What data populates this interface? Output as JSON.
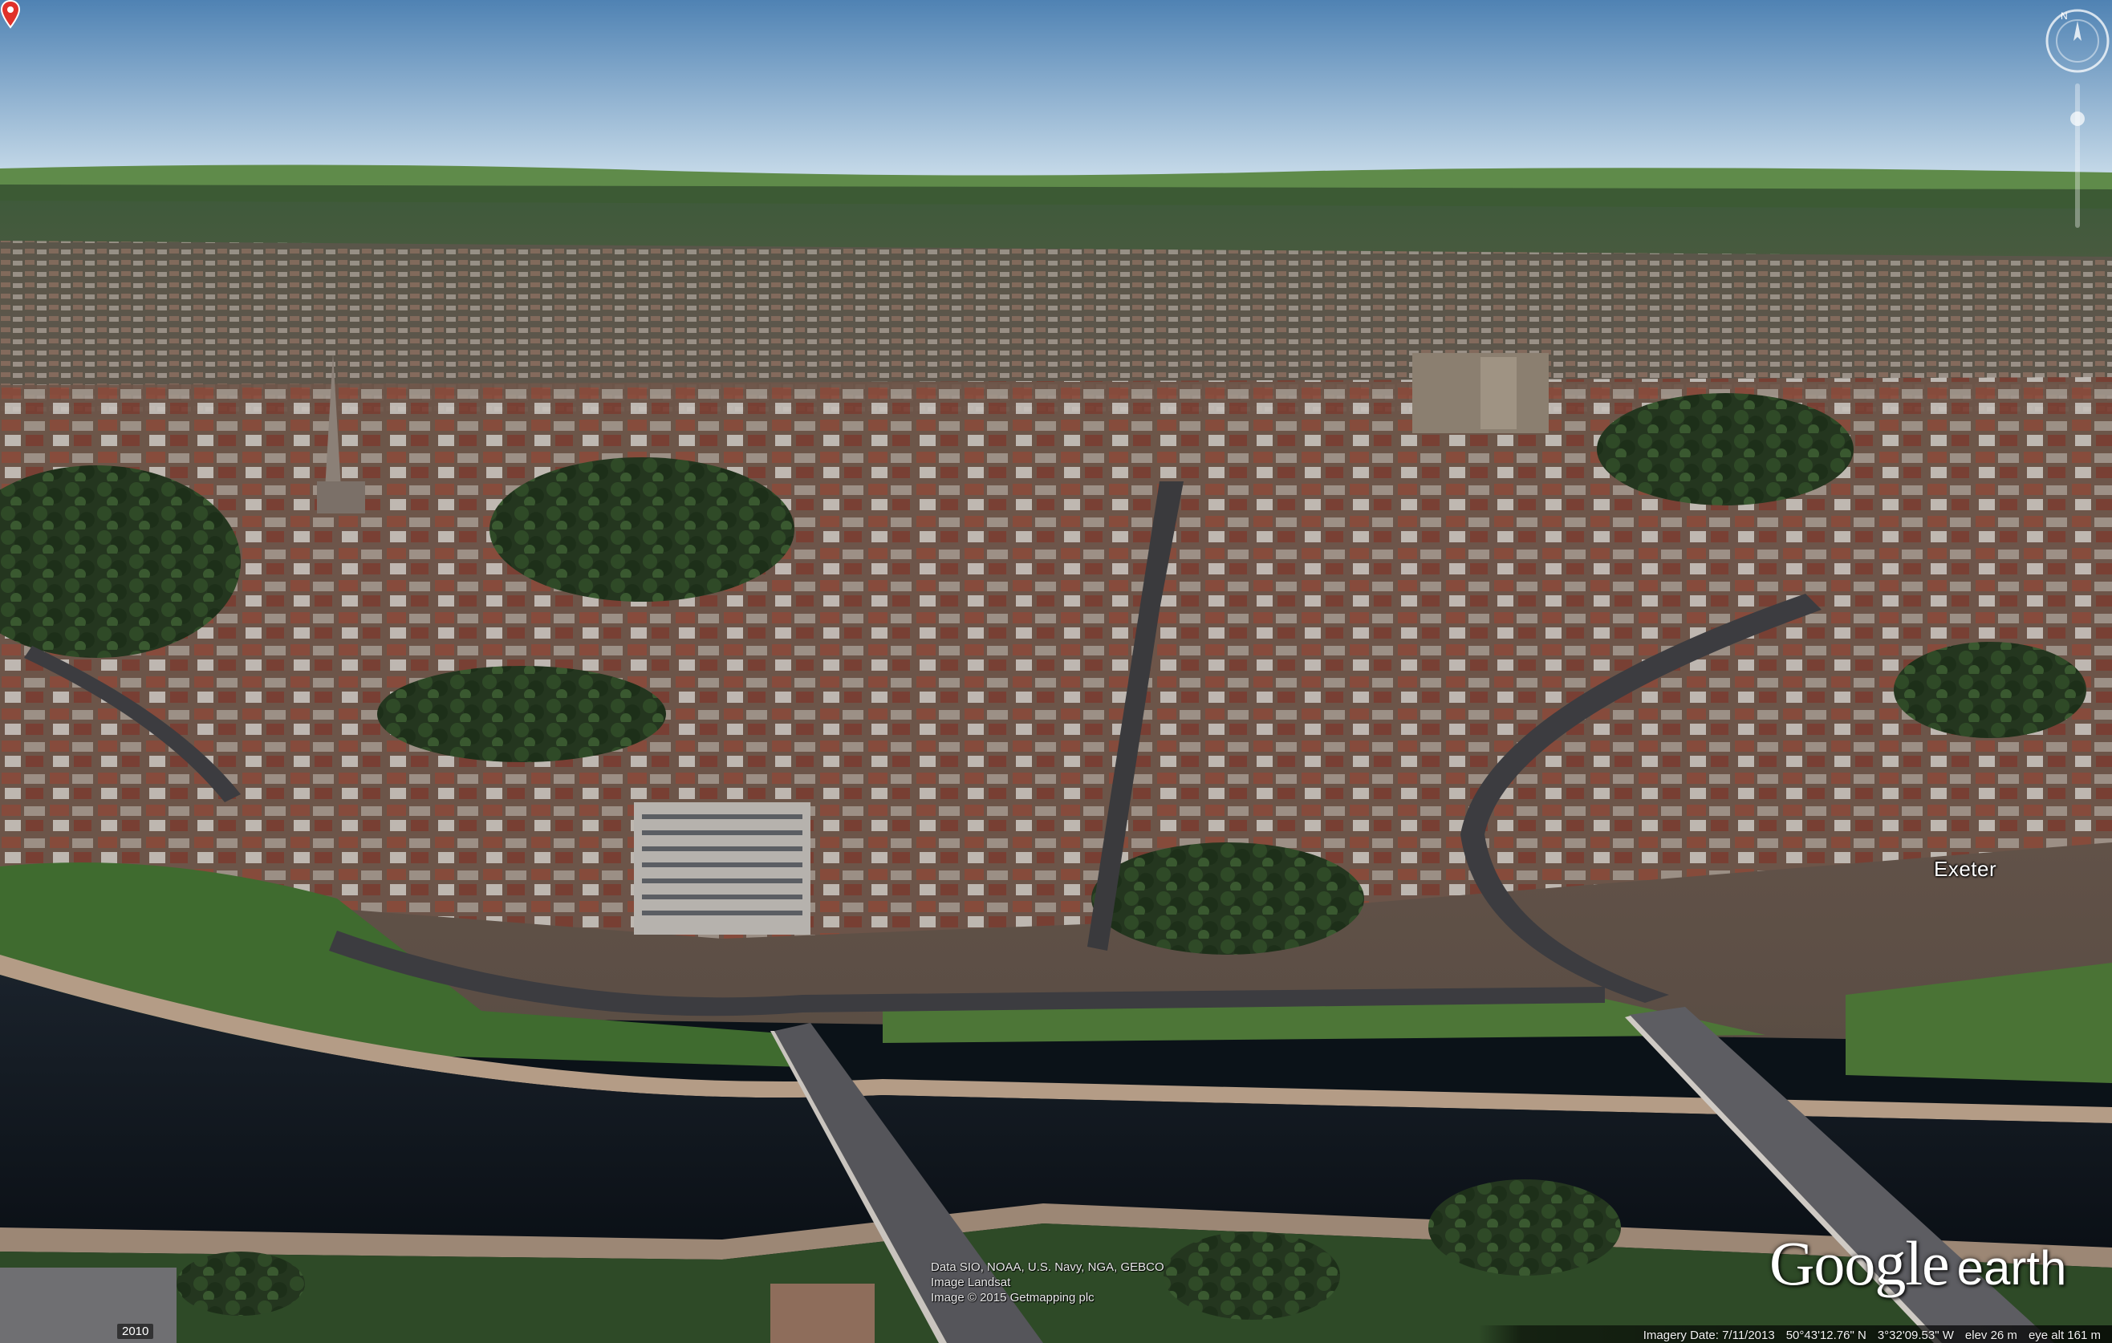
{
  "scene": {
    "place_label": "Exeter",
    "pin_icon": "map-pin-icon",
    "colors": {
      "sky_top": "#4f82b3",
      "sky_bottom": "#c9dcea",
      "hills": "#5f8b4a",
      "river": "#10171e",
      "brick_roofs": "#8a4a3a",
      "pin": "#e0312a"
    }
  },
  "attribution": {
    "line1": "Data SIO, NOAA, U.S. Navy, NGA, GEBCO",
    "line2": "Image Landsat",
    "line3": "Image © 2015 Getmapping plc"
  },
  "logo": {
    "google": "Google",
    "earth": "earth"
  },
  "year_badge": "2010",
  "status": {
    "imagery_date": "Imagery Date: 7/11/2013",
    "latitude": "50°43'12.76\" N",
    "longitude": "3°32'09.53\" W",
    "elevation": "elev   26 m",
    "eye_altitude": "eye alt   161 m"
  },
  "controls": {
    "compass_icon": "compass-icon",
    "zoom_icon": "zoom-slider-icon"
  }
}
